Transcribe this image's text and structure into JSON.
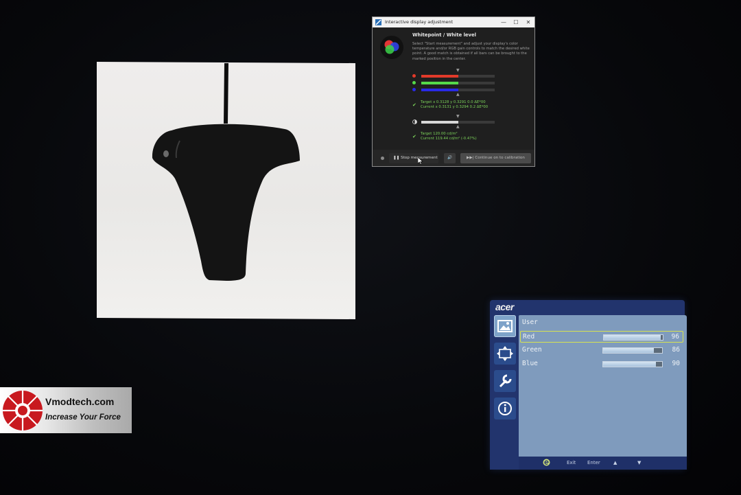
{
  "dialog": {
    "title": "Interactive display adjustment",
    "window_controls": [
      "—",
      "☐",
      "✕"
    ],
    "heading": "Whitepoint / White level",
    "description": "Select \"Start measurement\" and adjust your display's color temperature and/or RGB gain controls to match the desired white point. A good match is obtained if all bars can be brought to the marked position in the center.",
    "bars": [
      {
        "channel": "red",
        "color": "#e23a2a",
        "level": 0.5
      },
      {
        "channel": "green",
        "color": "#55d94a",
        "level": 0.5
      },
      {
        "channel": "blue",
        "color": "#2a2ae6",
        "level": 0.5
      }
    ],
    "whitepoint_target": "Target x 0.3128 y 0.3291 0.0 ΔE*00",
    "whitepoint_current": "Current x 0.3131 y 0.3294 0.2 ΔE*00",
    "luminance_bar": {
      "color": "#d7d7d7",
      "level": 0.5
    },
    "luminance_target": "Target 120.00 cd/m²",
    "luminance_current": "Current 119.44 cd/m² (-0.47%)",
    "stop_label": "Stop measurement",
    "continue_label": "Continue on to calibration"
  },
  "osd": {
    "brand": "acer",
    "mode": "User",
    "rows": [
      {
        "label": "Red",
        "value": "96",
        "level": 0.96
      },
      {
        "label": "Green",
        "value": "86",
        "level": 0.86
      },
      {
        "label": "Blue",
        "value": "90",
        "level": 0.9
      }
    ],
    "foot": {
      "exit": "Exit",
      "enter": "Enter",
      "up": "▲",
      "down": "▼"
    }
  },
  "watermark": {
    "site": "Vmodtech.com",
    "slogan": "Increase Your Force"
  }
}
